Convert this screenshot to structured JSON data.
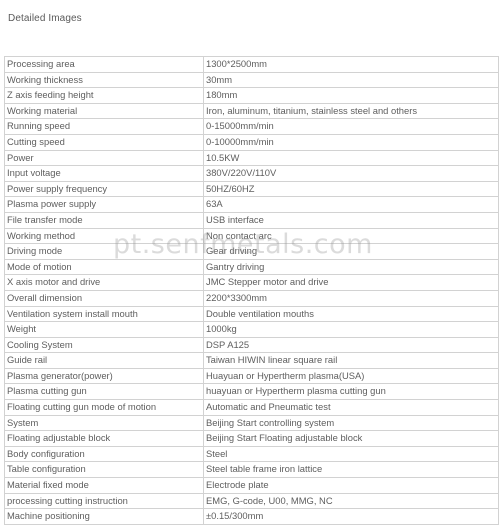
{
  "page": {
    "section_title": "Detailed Images",
    "watermark": "pt.senfmetals.com",
    "background_color": "#ffffff",
    "text_color": "#5e5e5e",
    "border_color": "#d2d2d2"
  },
  "spec_table": {
    "rows": [
      {
        "key": "Processing area",
        "value": "1300*2500mm"
      },
      {
        "key": "Working thickness",
        "value": "30mm"
      },
      {
        "key": "Z axis feeding height",
        "value": "180mm"
      },
      {
        "key": "Working material",
        "value": "Iron, aluminum, titanium, stainless steel and others"
      },
      {
        "key": "Running speed",
        "value": "0-15000mm/min"
      },
      {
        "key": "Cutting speed",
        "value": "0-10000mm/min"
      },
      {
        "key": "Power",
        "value": "10.5KW"
      },
      {
        "key": "Input voltage",
        "value": "380V/220V/110V"
      },
      {
        "key": "Power supply frequency",
        "value": "50HZ/60HZ"
      },
      {
        "key": "Plasma power supply",
        "value": "63A"
      },
      {
        "key": "File transfer mode",
        "value": "USB interface"
      },
      {
        "key": "Working method",
        "value": "Non contact arc"
      },
      {
        "key": "Driving mode",
        "value": "Gear driving"
      },
      {
        "key": "Mode of motion",
        "value": "Gantry driving"
      },
      {
        "key": "X axis motor and drive",
        "value": "JMC Stepper motor and drive"
      },
      {
        "key": "Overall dimension",
        "value": "2200*3300mm"
      },
      {
        "key": "Ventilation system install mouth",
        "value": "Double ventilation mouths"
      },
      {
        "key": "Weight",
        "value": "1000kg"
      },
      {
        "key": "Cooling System",
        "value": " DSP A125"
      },
      {
        "key": "Guide rail",
        "value": "Taiwan HIWIN linear square rail"
      },
      {
        "key": "Plasma generator(power)",
        "value": "Huayuan or Hypertherm plasma(USA)"
      },
      {
        "key": "Plasma cutting gun",
        "value": "huayuan or Hypertherm plasma cutting gun"
      },
      {
        "key": "Floating cutting gun mode of motion",
        "value": "Automatic and Pneumatic test"
      },
      {
        "key": "System",
        "value": "Beijing Start controlling system"
      },
      {
        "key": "Floating adjustable block",
        "value": "Beijing Start Floating adjustable block"
      },
      {
        "key": "Body configuration",
        "value": "Steel"
      },
      {
        "key": "Table configuration",
        "value": "Steel table frame iron lattice"
      },
      {
        "key": "Material fixed mode",
        "value": "Electrode plate"
      },
      {
        "key": "processing cutting instruction",
        "value": "EMG, G-code, U00, MMG, NC"
      },
      {
        "key": "Machine positioning",
        "value": "±0.15/300mm"
      }
    ]
  }
}
